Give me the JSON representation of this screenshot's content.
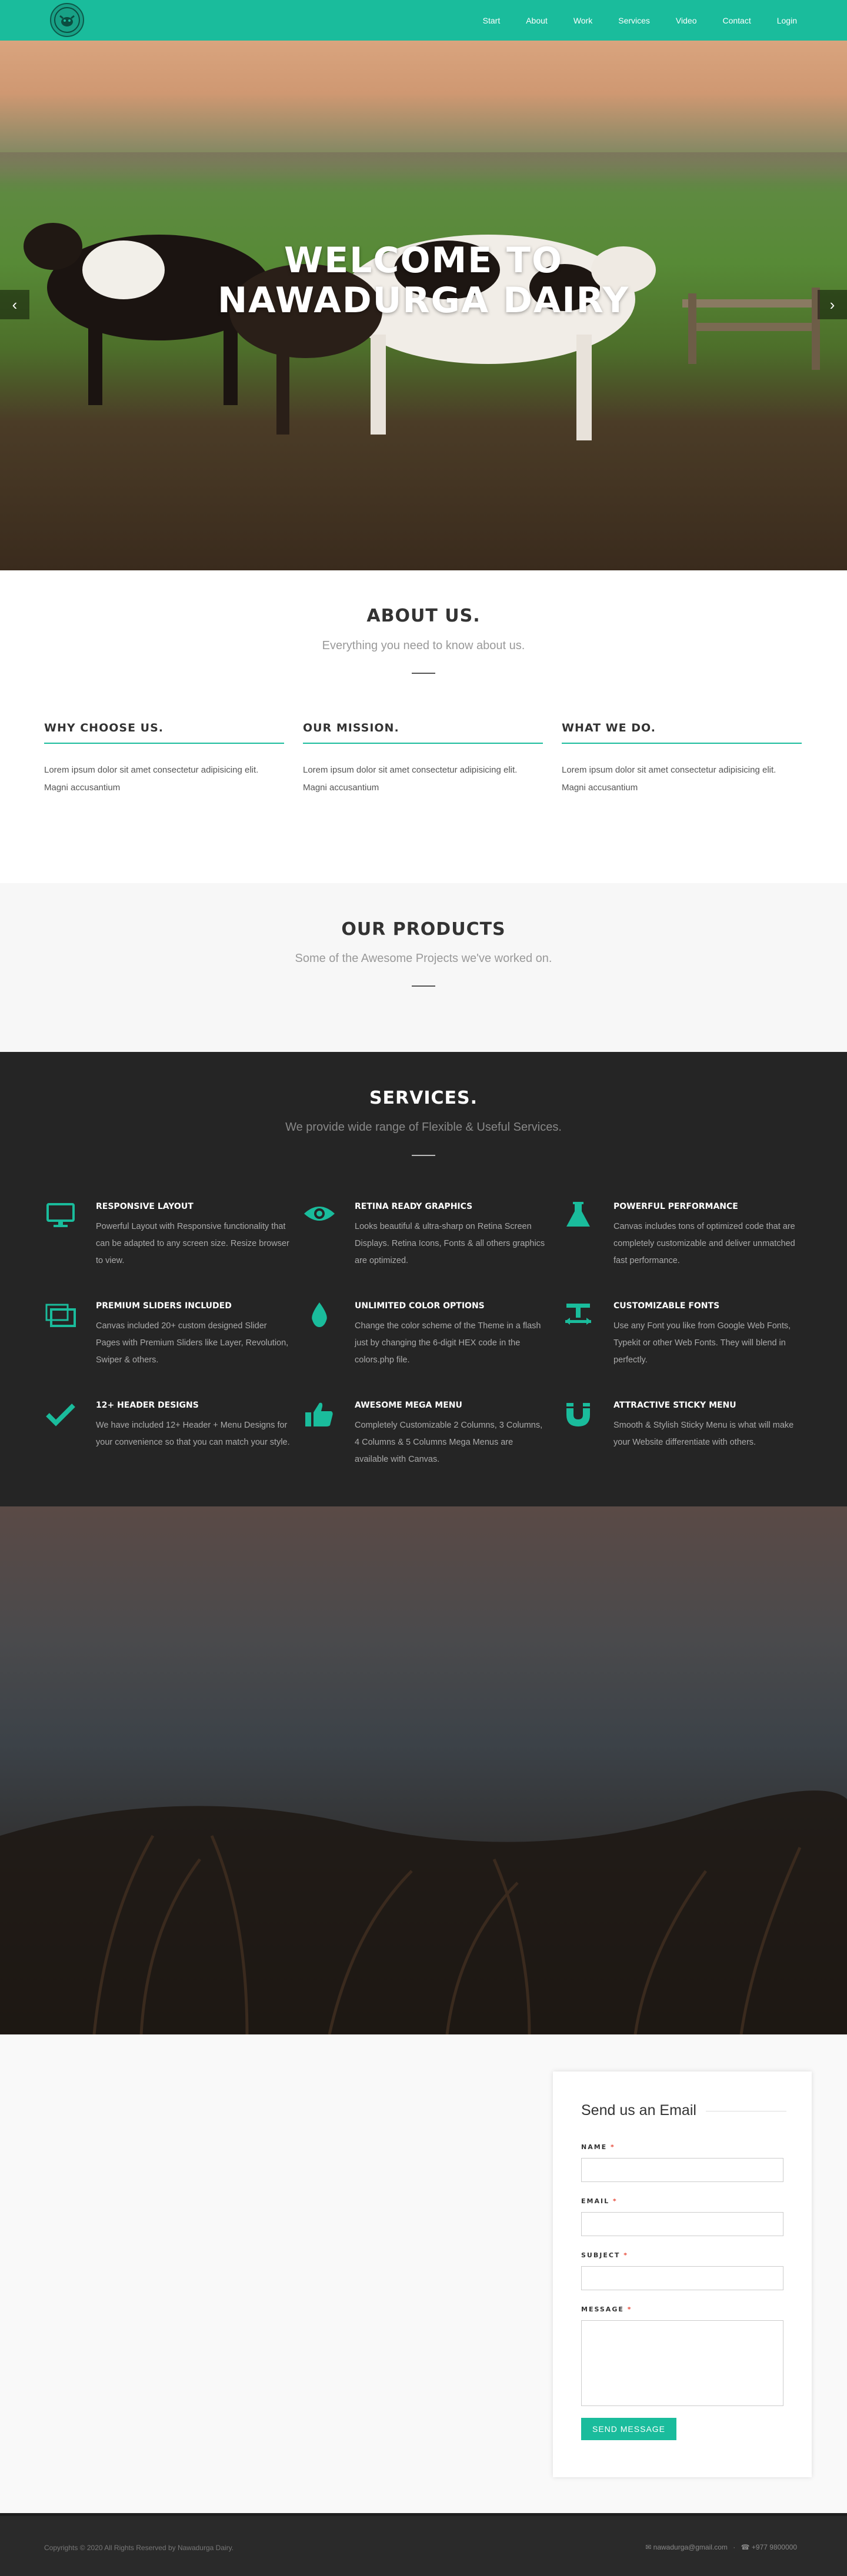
{
  "nav": {
    "items": [
      "Start",
      "About",
      "Work",
      "Services",
      "Video",
      "Contact",
      "Login"
    ]
  },
  "hero": {
    "line1": "WELCOME TO",
    "line2": "NAWADURGA DAIRY",
    "prev_icon": "chevron-left-icon",
    "next_icon": "chevron-right-icon"
  },
  "about": {
    "title": "ABOUT US.",
    "subtitle": "Everything you need to know about us.",
    "columns": [
      {
        "title": "WHY CHOOSE US.",
        "text": "Lorem ipsum dolor sit amet consectetur adipisicing elit. Magni accusantium"
      },
      {
        "title": "OUR MISSION.",
        "text": "Lorem ipsum dolor sit amet consectetur adipisicing elit. Magni accusantium"
      },
      {
        "title": "WHAT WE DO.",
        "text": "Lorem ipsum dolor sit amet consectetur adipisicing elit. Magni accusantium"
      }
    ]
  },
  "products": {
    "title": "OUR PRODUCTS",
    "subtitle": "Some of the Awesome Projects we've worked on."
  },
  "services": {
    "title": "SERVICES.",
    "subtitle": "We provide wide range of Flexible & Useful Services.",
    "items": [
      {
        "icon": "monitor-icon",
        "title": "RESPONSIVE LAYOUT",
        "text": "Powerful Layout with Responsive functionality that can be adapted to any screen size. Resize browser to view."
      },
      {
        "icon": "eye-icon",
        "title": "RETINA READY GRAPHICS",
        "text": "Looks beautiful & ultra-sharp on Retina Screen Displays. Retina Icons, Fonts & all others graphics are optimized."
      },
      {
        "icon": "flask-icon",
        "title": "POWERFUL PERFORMANCE",
        "text": "Canvas includes tons of optimized code that are completely customizable and deliver unmatched fast performance."
      },
      {
        "icon": "stack-icon",
        "title": "PREMIUM SLIDERS INCLUDED",
        "text": "Canvas included 20+ custom designed Slider Pages with Premium Sliders like Layer, Revolution, Swiper & others."
      },
      {
        "icon": "drop-icon",
        "title": "UNLIMITED COLOR OPTIONS",
        "text": "Change the color scheme of the Theme in a flash just by changing the 6-digit HEX code in the colors.php file."
      },
      {
        "icon": "text-size-icon",
        "title": "CUSTOMIZABLE FONTS",
        "text": "Use any Font you like from Google Web Fonts, Typekit or other Web Fonts. They will blend in perfectly."
      },
      {
        "icon": "check-icon",
        "title": "12+ HEADER DESIGNS",
        "text": "We have included 12+ Header + Menu Designs for your convenience so that you can match your style."
      },
      {
        "icon": "thumbs-up-icon",
        "title": "AWESOME MEGA MENU",
        "text": "Completely Customizable 2 Columns, 3 Columns, 4 Columns & 5 Columns Mega Menus are available with Canvas."
      },
      {
        "icon": "magnet-icon",
        "title": "ATTRACTIVE STICKY MENU",
        "text": "Smooth & Stylish Sticky Menu is what will make your Website differentiate with others."
      }
    ]
  },
  "contact": {
    "title": "Send us an Email",
    "name_label": "NAME",
    "email_label": "EMAIL",
    "subject_label": "SUBJECT",
    "message_label": "MESSAGE",
    "required": "*",
    "button": "SEND MESSAGE"
  },
  "footer": {
    "copyright": "Copyrights © 2020 All Rights Reserved by Nawadurga Dairy.",
    "email": "nawadurga@gmail.com",
    "separator": "·",
    "phone": "+977 9800000",
    "email_icon": "envelope-icon",
    "phone_icon": "headphones-icon"
  },
  "colors": {
    "accent": "#1abc9c",
    "dark": "#252525",
    "footer": "#2a2a2a"
  }
}
